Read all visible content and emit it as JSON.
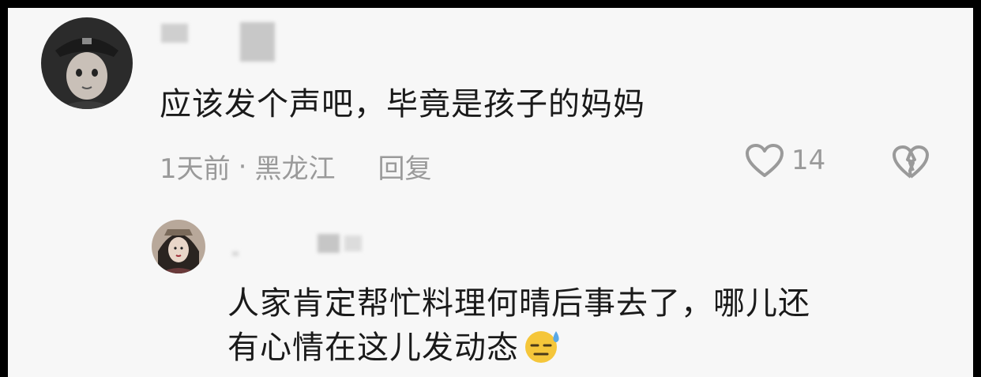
{
  "comment1": {
    "text": "应该发个声吧，毕竟是孩子的妈妈",
    "time": "1天前",
    "separator": "·",
    "location": "黑龙江",
    "reply_label": "回复",
    "like_count": "14",
    "icons": {
      "like": "heart-outline-icon",
      "dislike": "broken-heart-icon"
    }
  },
  "comment2": {
    "text_line1": "人家肯定帮忙料理何晴后事去了，哪儿还",
    "text_line2": "有心情在这儿发动态",
    "emoji": "sweat-face-emoji"
  },
  "colors": {
    "background": "#f7f7f7",
    "text": "#1a1a1a",
    "meta": "#9a9a9a",
    "frame": "#000000"
  }
}
